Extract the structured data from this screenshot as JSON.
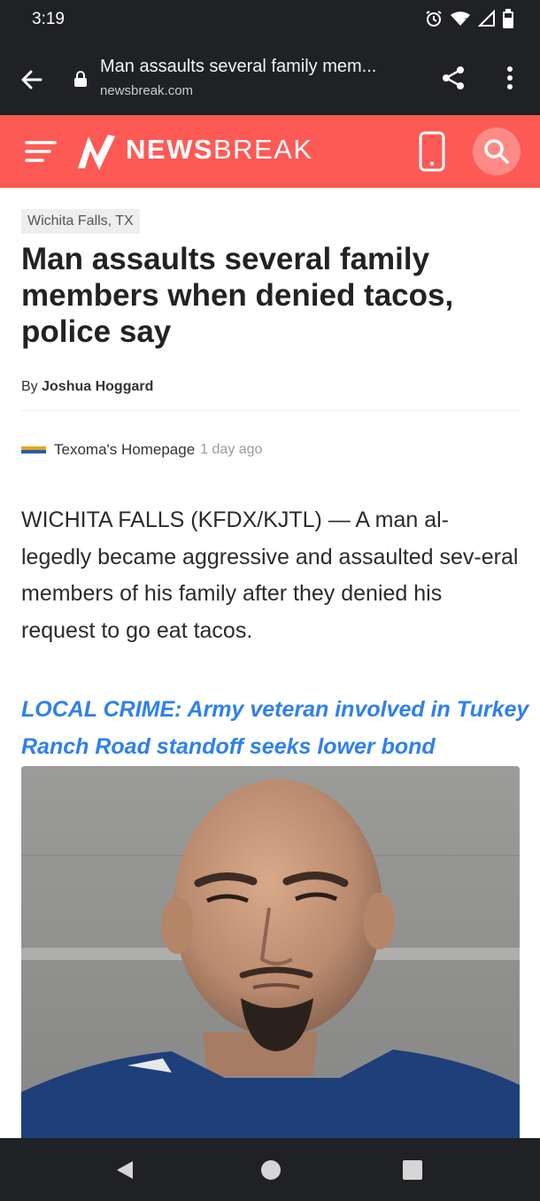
{
  "status_bar": {
    "time": "3:19",
    "icons": [
      "alarm-icon",
      "wifi-icon",
      "signal-icon",
      "battery-icon"
    ]
  },
  "browser": {
    "page_title": "Man assaults several family mem...",
    "domain": "newsbreak.com",
    "icons": [
      "back-arrow-icon",
      "lock-icon",
      "share-icon",
      "more-vert-icon"
    ]
  },
  "header": {
    "brand_bold": "NEWS",
    "brand_light": "BREAK",
    "bg_color": "#fd5a55",
    "icons": [
      "hamburger-icon",
      "newsbreak-logo",
      "phone-icon",
      "search-icon"
    ]
  },
  "article": {
    "location": "Wichita Falls, TX",
    "headline": "Man assaults several family members when denied tacos, police say",
    "byline_prefix": "By",
    "author": "Joshua Hoggard",
    "source_name": "Texoma's Homepage",
    "published": "1 day ago",
    "body": "WICHITA FALLS (KFDX/KJTL) — A man al-legedly became aggressive and assaulted sev-eral members of his family after they denied his request to go eat tacos.",
    "related_link": "LOCAL CRIME: Army veteran involved in Turkey Ranch Road standoff seeks lower bond",
    "link_color": "#2f80ed"
  },
  "nav_bar": {
    "icons": [
      "nav-back-icon",
      "nav-home-icon",
      "nav-recents-icon"
    ]
  }
}
